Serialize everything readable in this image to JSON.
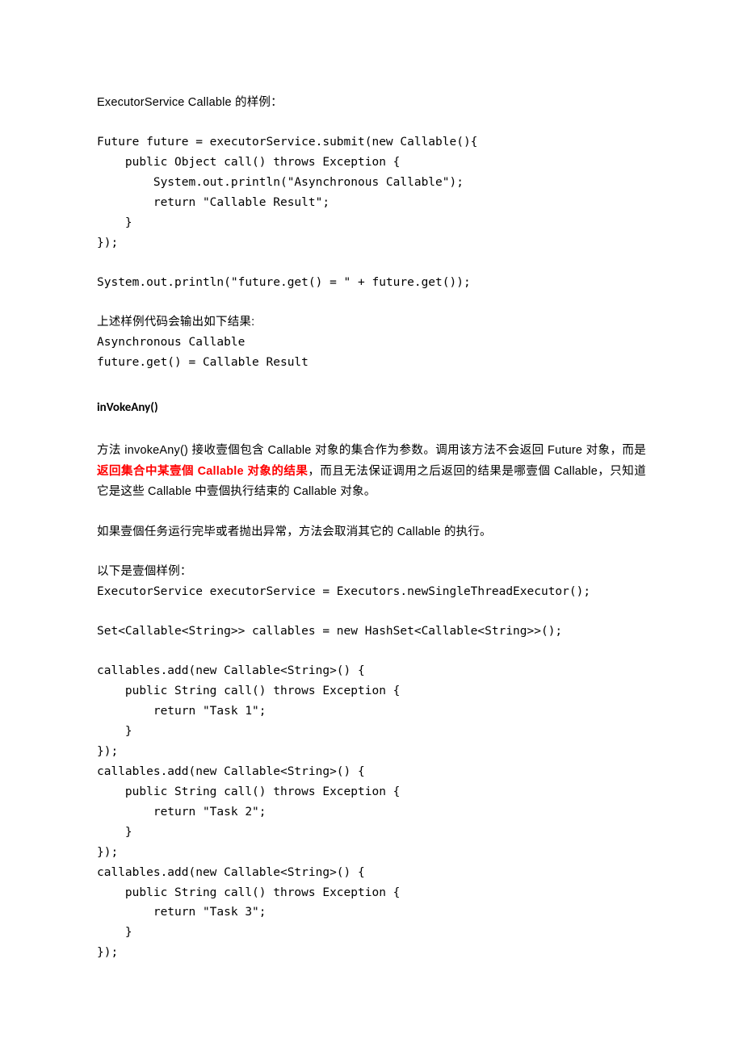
{
  "intro_label": "ExecutorService Callable 的样例：",
  "code1": "Future future = executorService.submit(new Callable(){\n    public Object call() throws Exception {\n        System.out.println(\"Asynchronous Callable\");\n        return \"Callable Result\";\n    }\n});",
  "code2": "System.out.println(\"future.get() = \" + future.get());",
  "result_intro": "上述样例代码会输出如下结果:",
  "result_code": "Asynchronous Callable\nfuture.get() = Callable Result",
  "heading2": "inVokeAny()",
  "para1_pre": "方法 invokeAny() 接收壹個包含 Callable 对象的集合作为参数。调用该方法不会返回 Future 对象，而是",
  "para1_red": "返回集合中某壹個 Callable 对象的结果",
  "para1_post": "，而且无法保证调用之后返回的结果是哪壹個 Callable，只知道它是这些 Callable 中壹個执行结束的 Callable 对象。",
  "para2": "如果壹個任务运行完毕或者抛出异常，方法会取消其它的 Callable 的执行。",
  "example_intro": "以下是壹個样例：",
  "code3": "ExecutorService executorService = Executors.newSingleThreadExecutor();",
  "code4": "Set<Callable<String>> callables = new HashSet<Callable<String>>();",
  "code5": "callables.add(new Callable<String>() {\n    public String call() throws Exception {\n        return \"Task 1\";\n    }\n});\ncallables.add(new Callable<String>() {\n    public String call() throws Exception {\n        return \"Task 2\";\n    }\n});\ncallables.add(new Callable<String>() {\n    public String call() throws Exception {\n        return \"Task 3\";\n    }\n});"
}
